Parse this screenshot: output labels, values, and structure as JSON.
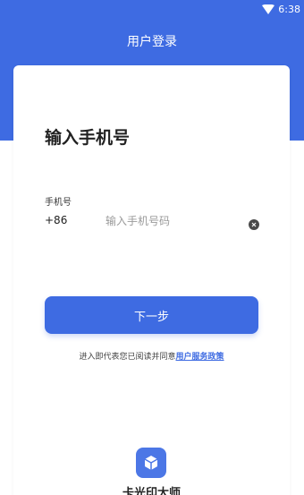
{
  "status_bar": {
    "time": "6:38"
  },
  "header": {
    "title": "用户登录"
  },
  "card": {
    "title": "输入手机号",
    "phone_label": "手机号",
    "country_code": "+86",
    "phone_placeholder": "输入手机号码",
    "next_button_label": "下一步",
    "agreement_prefix": "进入即代表您已阅读并同意",
    "agreement_link": "用户服务政策"
  },
  "app": {
    "name": "卡光印大师"
  },
  "colors": {
    "accent": "#3e6be2"
  }
}
